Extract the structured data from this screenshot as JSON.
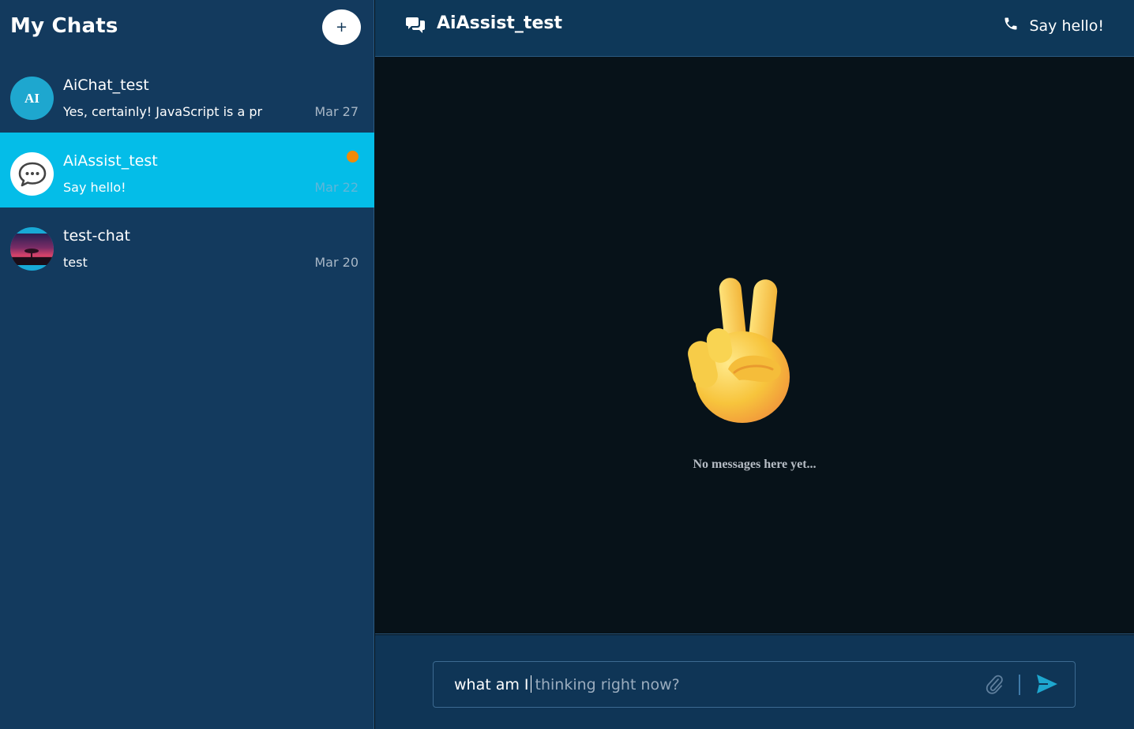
{
  "sidebar": {
    "title": "My Chats",
    "new_chat_label": "+",
    "chats": [
      {
        "name": "AiChat_test",
        "preview": "Yes, certainly! JavaScript is a pr",
        "date": "Mar 27",
        "avatar_text": "AI",
        "active": false
      },
      {
        "name": "AiAssist_test",
        "preview": "Say hello!",
        "date": "Mar 22",
        "avatar_icon": "chat-bubbles-icon",
        "active": true,
        "unread": true
      },
      {
        "name": "test-chat",
        "preview": "test",
        "date": "Mar 20",
        "avatar_icon": "landscape-photo",
        "active": false
      }
    ]
  },
  "header": {
    "title": "AiAssist_test",
    "call_label": "Say hello!"
  },
  "messages": {
    "empty_text": "No messages here yet...",
    "empty_icon": "victory-hand-emoji"
  },
  "composer": {
    "typed": "what am I",
    "placeholder_hint": "thinking right now?"
  },
  "colors": {
    "sidebar_bg": "#133a5e",
    "active_bg": "#04bde8",
    "unread_dot": "#f08a08",
    "accent": "#1ea7cf",
    "messages_bg": "#071219"
  }
}
